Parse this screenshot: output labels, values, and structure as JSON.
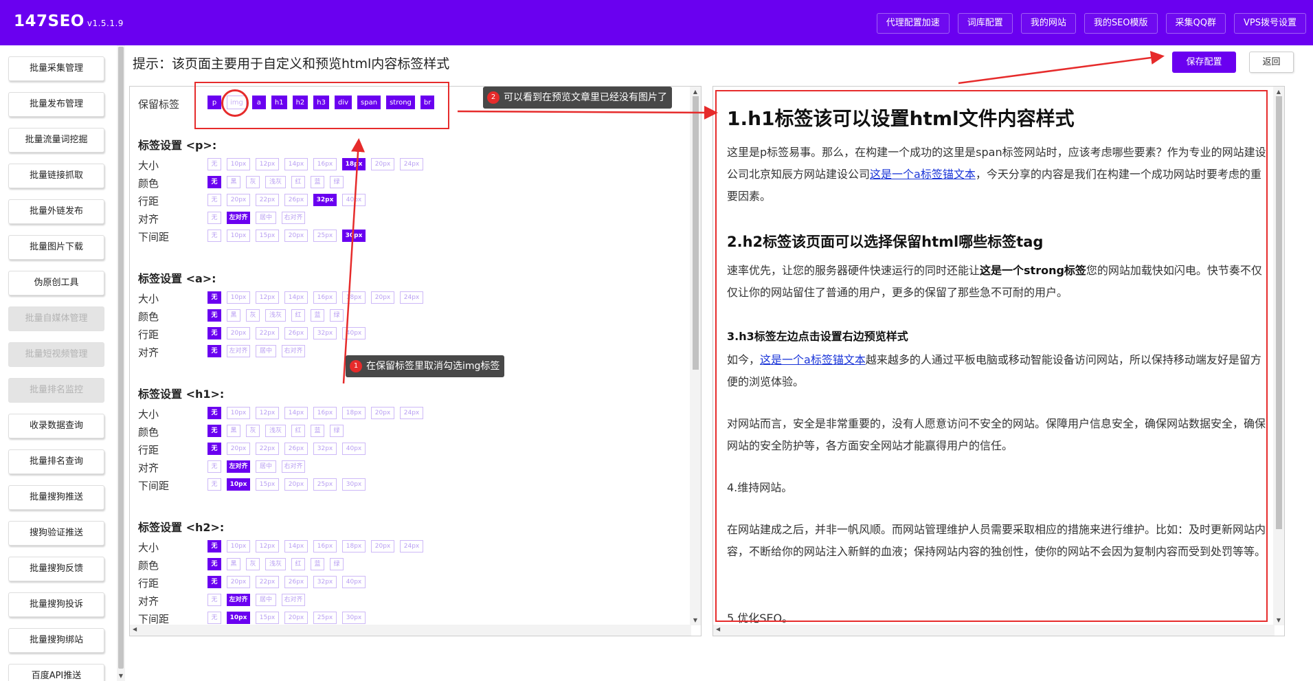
{
  "header": {
    "brand": "147SEO",
    "version": "v1.5.1.9",
    "nav": [
      "代理配置加速",
      "词库配置",
      "我的网站",
      "我的SEO模版",
      "采集QQ群",
      "VPS拨号设置"
    ]
  },
  "sidebar": {
    "items": [
      {
        "label": "批量采集管理",
        "disabled": false
      },
      {
        "label": "批量发布管理",
        "disabled": false
      },
      {
        "label": "批量流量词挖掘",
        "disabled": false
      },
      {
        "label": "批量链接抓取",
        "disabled": false
      },
      {
        "label": "批量外链发布",
        "disabled": false
      },
      {
        "label": "批量图片下载",
        "disabled": false
      },
      {
        "label": "伪原创工具",
        "disabled": false
      },
      {
        "label": "批量自媒体管理",
        "disabled": true
      },
      {
        "label": "批量短视频管理",
        "disabled": true
      },
      {
        "label": "批量排名监控",
        "disabled": true
      },
      {
        "label": "收录数据查询",
        "disabled": false
      },
      {
        "label": "批量排名查询",
        "disabled": false
      },
      {
        "label": "批量搜狗推送",
        "disabled": false
      },
      {
        "label": "搜狗验证推送",
        "disabled": false
      },
      {
        "label": "批量搜狗反馈",
        "disabled": false
      },
      {
        "label": "批量搜狗投诉",
        "disabled": false
      },
      {
        "label": "批量搜狗绑站",
        "disabled": false
      },
      {
        "label": "百度API推送",
        "disabled": false
      }
    ]
  },
  "hint": "提示：该页面主要用于自定义和预览html内容标签样式",
  "actions": {
    "save": "保存配置",
    "back": "返回"
  },
  "settings": {
    "keep_label": "保留标签",
    "keep_tags": [
      {
        "name": "p",
        "on": true
      },
      {
        "name": "img",
        "on": false
      },
      {
        "name": "a",
        "on": true
      },
      {
        "name": "h1",
        "on": true
      },
      {
        "name": "h2",
        "on": true
      },
      {
        "name": "h3",
        "on": true
      },
      {
        "name": "div",
        "on": true
      },
      {
        "name": "span",
        "on": true
      },
      {
        "name": "strong",
        "on": true
      },
      {
        "name": "br",
        "on": true
      }
    ],
    "row_labels": {
      "size": "大小",
      "color": "颜色",
      "line_height": "行距",
      "align": "对齐",
      "margin_bottom": "下间距"
    },
    "options": {
      "size": [
        "无",
        "10px",
        "12px",
        "14px",
        "16px",
        "18px",
        "20px",
        "24px"
      ],
      "color": [
        "无",
        "黑",
        "灰",
        "浅灰",
        "红",
        "蓝",
        "绿"
      ],
      "line_height": [
        "无",
        "20px",
        "22px",
        "26px",
        "32px",
        "40px"
      ],
      "align": [
        "无",
        "左对齐",
        "居中",
        "右对齐"
      ],
      "margin_bottom": [
        "无",
        "10px",
        "15px",
        "20px",
        "25px",
        "30px"
      ]
    },
    "sections": [
      {
        "title": "标签设置 <p>:",
        "size": 5,
        "color": 0,
        "line_height": 4,
        "align": 1,
        "margin_bottom": 5
      },
      {
        "title": "标签设置 <a>:",
        "size": 0,
        "color": 0,
        "line_height": 0,
        "align": 0
      },
      {
        "title": "标签设置 <h1>:",
        "size": 0,
        "color": 0,
        "line_height": 0,
        "align": 1,
        "margin_bottom": 1
      },
      {
        "title": "标签设置 <h2>:",
        "size": 0,
        "color": 0,
        "line_height": 0,
        "align": 1,
        "margin_bottom": 1
      }
    ]
  },
  "preview": {
    "h1": "1.h1标签该可以设置html文件内容样式",
    "p1_a": "这里是p标签易事。那么，在构建一个成功的这里是span标签网站时，应该考虑哪些要素？作为专业的网站建设公司北京知辰方网站建设公司",
    "p1_link": "这是一个a标签锚文本",
    "p1_b": "，今天分享的内容是我们在构建一个成功网站时要考虑的重要因素。",
    "h2": "2.h2标签该页面可以选择保留html哪些标签tag",
    "p2_a": "速率优先，让您的服务器硬件快速运行的同时还能让",
    "p2_strong": "这是一个strong标签",
    "p2_b": "您的网站加载快如闪电。快节奏不仅仅让你的网站留住了普通的用户，更多的保留了那些急不可耐的用户。",
    "h3": "3.h3标签左边点击设置右边预览样式",
    "p3_a": "如今，",
    "p3_link": "这是一个a标签锚文本",
    "p3_b": "越来越多的人通过平板电脑或移动智能设备访问网站，所以保持移动端友好是留方便的浏览体验。",
    "p4": "对网站而言，安全是非常重要的，没有人愿意访问不安全的网站。保障用户信息安全，确保网站数据安全，确保网站的安全防护等，各方面安全网站才能赢得用户的信任。",
    "p5": "4.维持网站。",
    "p6": "在网站建成之后，并非一帆风顺。而网站管理维护人员需要采取相应的措施来进行维护。比如：及时更新网站内容，不断给你的网站注入新鲜的血液；保持网站内容的独创性，使你的网站不会因为复制内容而受到处罚等等。",
    "p7": "5.优化SEO。"
  },
  "annotations": [
    {
      "num": "1",
      "text": "在保留标签里取消勾选img标签"
    },
    {
      "num": "2",
      "text": "可以看到在预览文章里已经没有图片了"
    }
  ],
  "colors": {
    "accent": "#6a00f0",
    "annotation": "#e62b2b"
  }
}
